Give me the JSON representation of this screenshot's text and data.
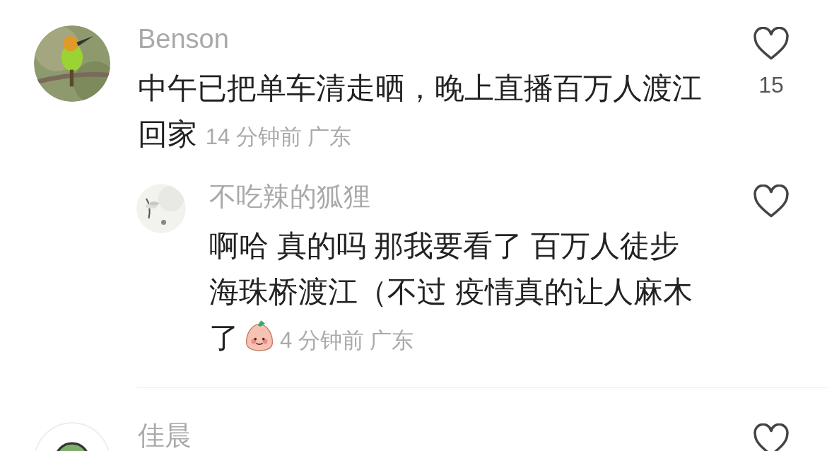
{
  "comments": [
    {
      "author": "Benson",
      "text": "中午已把单车清走晒，晚上直播百万人渡江回家",
      "time": "14 分钟前",
      "location": "广东",
      "likes": "15",
      "liked": false,
      "avatar": {
        "kind": "picture"
      },
      "replies": [
        {
          "author": "不吃辣的狐狸",
          "text": "啊哈 真的吗 那我要看了 百万人徒步海珠桥渡江（不过 疫情真的让人麻木了",
          "has_emoji": true,
          "time": "4 分钟前",
          "location": "广东",
          "liked": false,
          "avatar": {
            "kind": "picture"
          }
        }
      ]
    },
    {
      "author": "佳晨",
      "liked": false,
      "avatar": {
        "kind": "picture"
      }
    }
  ]
}
